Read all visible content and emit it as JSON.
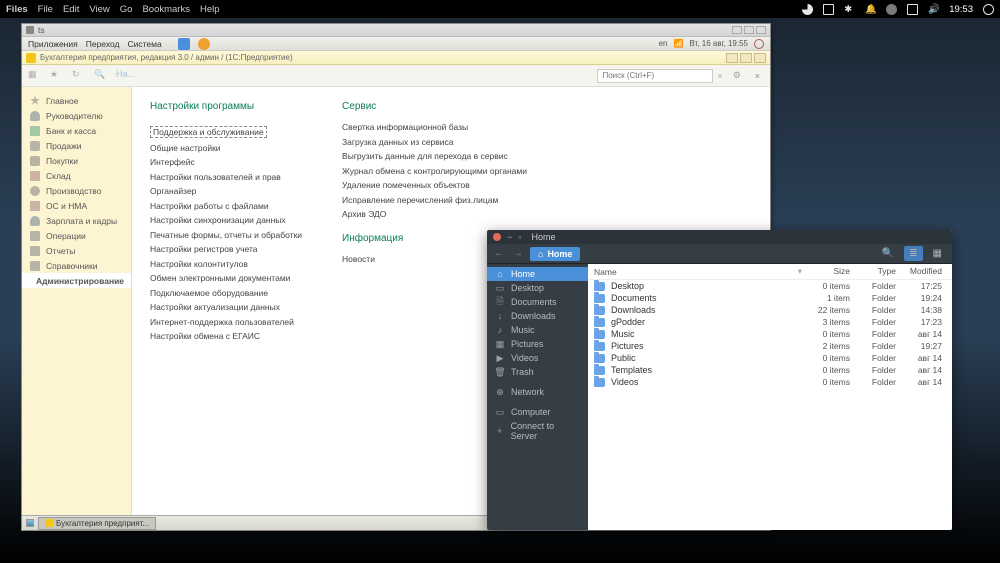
{
  "topbar": {
    "left": [
      "Files",
      "File",
      "Edit",
      "View",
      "Go",
      "Bookmarks",
      "Help"
    ],
    "time": "19:53"
  },
  "win1": {
    "title": "ts",
    "menu": [
      "Приложения",
      "Переход",
      "Система"
    ],
    "menu_right_date": "Вт, 16 авг, 19:55",
    "app_title": "Бухгалтерия предприятия, редакция 3.0 / админ / (1С:Предприятие)",
    "search_placeholder": "Поиск (Ctrl+F)",
    "taskbar_item": "Бухгалтерия предприят...",
    "sidebar": [
      {
        "label": "Главное",
        "icon": "ic-star"
      },
      {
        "label": "Руководителю",
        "icon": "ic-person"
      },
      {
        "label": "Банк и касса",
        "icon": "ic-bank"
      },
      {
        "label": "Продажи",
        "icon": "ic-cart"
      },
      {
        "label": "Покупки",
        "icon": "ic-cart"
      },
      {
        "label": "Склад",
        "icon": "ic-box"
      },
      {
        "label": "Производство",
        "icon": "ic-gear"
      },
      {
        "label": "ОС и НМА",
        "icon": "ic-box"
      },
      {
        "label": "Зарплата и кадры",
        "icon": "ic-person"
      },
      {
        "label": "Операции",
        "icon": "ic-list"
      },
      {
        "label": "Отчеты",
        "icon": "ic-list"
      },
      {
        "label": "Справочники",
        "icon": "ic-list"
      },
      {
        "label": "Администрирование",
        "icon": "ic-gear",
        "selected": true
      }
    ],
    "column1_heading": "Настройки программы",
    "column1": [
      "Поддержка и обслуживание",
      "Общие настройки",
      "Интерфейс",
      "Настройки пользователей и прав",
      "Органайзер",
      "Настройки работы с файлами",
      "Настройки синхронизации данных",
      "Печатные формы, отчеты и обработки",
      "Настройки регистров учета",
      "Настройки колонтитулов",
      "Обмен электронными документами",
      "Подключаемое оборудование",
      "Настройки актуализации данных",
      "Интернет-поддержка пользователей",
      "Настройки обмена с ЕГАИС"
    ],
    "column2_heading": "Сервис",
    "column2": [
      "Свертка информационной базы",
      "Загрузка данных из сервиса",
      "Выгрузить данные для перехода в сервис",
      "Журнал обмена с контролирующими органами",
      "Удаление помеченных объектов",
      "Исправление перечислений физ.лицам",
      "Архив ЭДО"
    ],
    "column3_heading": "Информация",
    "column3": [
      "Новости"
    ]
  },
  "files": {
    "title": "Home",
    "path_button": "Home",
    "sidebar": [
      {
        "label": "Home",
        "icon": "⌂",
        "selected": true
      },
      {
        "label": "Desktop",
        "icon": "▭"
      },
      {
        "label": "Documents",
        "icon": "🗎"
      },
      {
        "label": "Downloads",
        "icon": "↓"
      },
      {
        "label": "Music",
        "icon": "♪"
      },
      {
        "label": "Pictures",
        "icon": "▦"
      },
      {
        "label": "Videos",
        "icon": "▶"
      },
      {
        "label": "Trash",
        "icon": "🗑"
      }
    ],
    "sidebar2": [
      {
        "label": "Network",
        "icon": "⊕"
      }
    ],
    "sidebar3": [
      {
        "label": "Computer",
        "icon": "▭"
      },
      {
        "label": "Connect to Server",
        "icon": "+"
      }
    ],
    "columns": {
      "name": "Name",
      "size": "Size",
      "type": "Type",
      "modified": "Modified"
    },
    "rows": [
      {
        "name": "Desktop",
        "size": "0 items",
        "type": "Folder",
        "modified": "17:25"
      },
      {
        "name": "Documents",
        "size": "1 item",
        "type": "Folder",
        "modified": "19:24"
      },
      {
        "name": "Downloads",
        "size": "22 items",
        "type": "Folder",
        "modified": "14:38"
      },
      {
        "name": "gPodder",
        "size": "3 items",
        "type": "Folder",
        "modified": "17:23"
      },
      {
        "name": "Music",
        "size": "0 items",
        "type": "Folder",
        "modified": "авг 14"
      },
      {
        "name": "Pictures",
        "size": "2 items",
        "type": "Folder",
        "modified": "19:27"
      },
      {
        "name": "Public",
        "size": "0 items",
        "type": "Folder",
        "modified": "авг 14"
      },
      {
        "name": "Templates",
        "size": "0 items",
        "type": "Folder",
        "modified": "авг 14"
      },
      {
        "name": "Videos",
        "size": "0 items",
        "type": "Folder",
        "modified": "авг 14"
      }
    ]
  }
}
